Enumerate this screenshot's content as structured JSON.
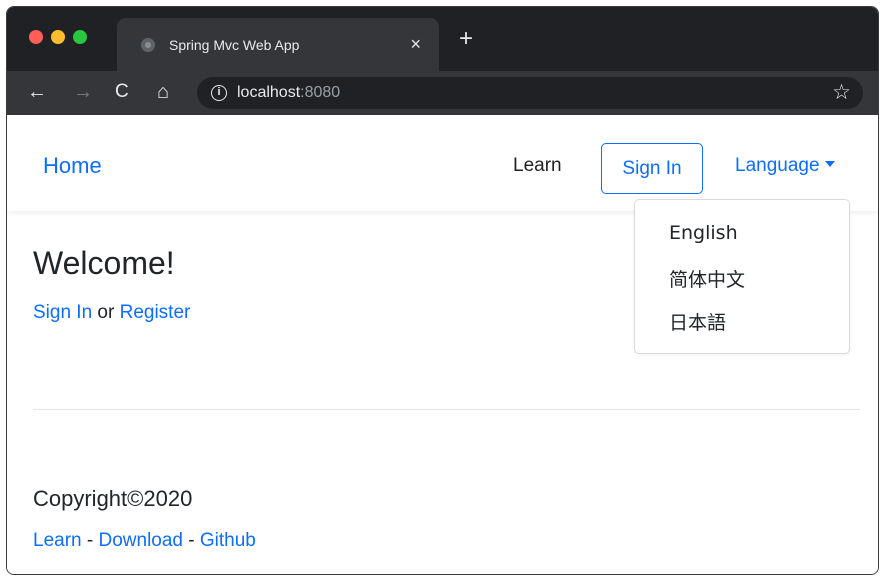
{
  "browser": {
    "tab_title": "Spring Mvc Web App",
    "tab_close": "×",
    "new_tab": "+",
    "back": "←",
    "forward": "→",
    "reload": "C",
    "home": "⌂",
    "info": "i",
    "url_host": "localhost",
    "url_port": ":8080",
    "star": "☆"
  },
  "navbar": {
    "brand": "Home",
    "learn": "Learn",
    "sign_in": "Sign In",
    "language": "Language"
  },
  "language_menu": {
    "items": [
      "English",
      "简体中文",
      "日本語"
    ]
  },
  "main": {
    "heading": "Welcome!",
    "sign_in_link": "Sign In",
    "or_text": " or ",
    "register_link": "Register"
  },
  "footer": {
    "copyright": "Copyright©2020",
    "links": [
      "Learn",
      "Download",
      "Github"
    ],
    "separator": " - "
  }
}
